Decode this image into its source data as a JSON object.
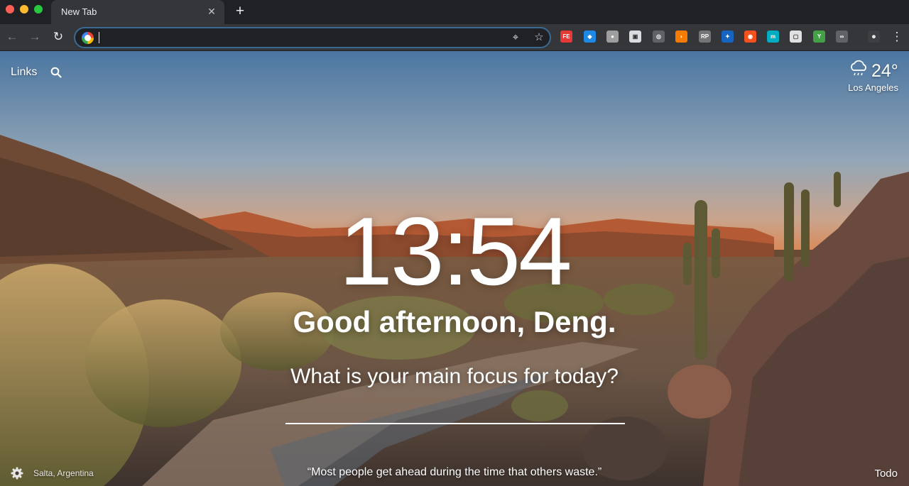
{
  "browser": {
    "tab_title": "New Tab",
    "tab_close_glyph": "✕",
    "new_tab_glyph": "+",
    "back_glyph": "←",
    "forward_glyph": "→",
    "reload_glyph": "↻",
    "omnibox_value": "",
    "lens_glyph": "⌖",
    "bookmark_glyph": "☆",
    "menu_glyph": "⋮",
    "extensions": [
      {
        "name": "fe-extension-icon",
        "label": "FE",
        "color": "#e53935"
      },
      {
        "name": "diamond-extension-icon",
        "label": "◆",
        "color": "#1e88e5"
      },
      {
        "name": "gray-extension-icon",
        "label": "●",
        "color": "#9e9e9e"
      },
      {
        "name": "document-extension-icon",
        "label": "▣",
        "color": "#dadce0"
      },
      {
        "name": "grey-box-extension-icon",
        "label": "◎",
        "color": "#5f6368"
      },
      {
        "name": "orange-extension-icon",
        "label": "◗",
        "color": "#f57c00"
      },
      {
        "name": "rp-extension-icon",
        "label": "RP",
        "color": "#757575"
      },
      {
        "name": "blue-bird-extension-icon",
        "label": "✦",
        "color": "#1565c0"
      },
      {
        "name": "orange-circle-extension-icon",
        "label": "◉",
        "color": "#f4511e"
      },
      {
        "name": "teal-extension-icon",
        "label": "m",
        "color": "#00acc1"
      },
      {
        "name": "white-box-extension-icon",
        "label": "▢",
        "color": "#e0e0e0"
      },
      {
        "name": "green-extension-icon",
        "label": "Y",
        "color": "#43a047"
      },
      {
        "name": "glasses-extension-icon",
        "label": "∞",
        "color": "#5f6368"
      },
      {
        "name": "profile-avatar-icon",
        "label": "☻",
        "color": "#3c4043"
      }
    ]
  },
  "momentum": {
    "links_label": "Links",
    "weather": {
      "temperature": "24°",
      "location": "Los Angeles"
    },
    "time": "13:54",
    "greeting": "Good afternoon, Deng.",
    "focus_question": "What is your main focus for today?",
    "focus_value": "",
    "photo_location": "Salta, Argentina",
    "quote": "“Most people get ahead during the time that others waste.”",
    "todo_label": "Todo"
  }
}
